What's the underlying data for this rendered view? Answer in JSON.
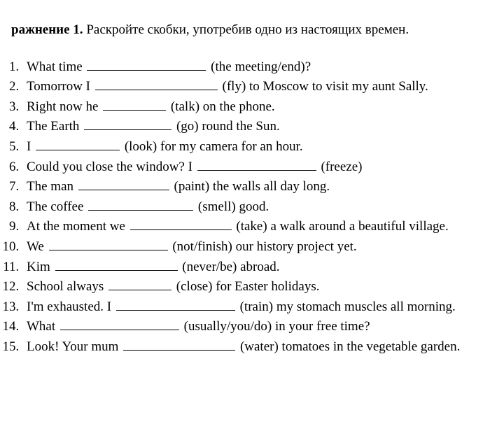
{
  "heading": {
    "label_bold": "ражнение 1.",
    "instruction": "Раскройте скобки, употребив одно из настоящих времен."
  },
  "items": [
    {
      "pre": "What time ",
      "blank_w": 170,
      "post": " (the meeting/end)?"
    },
    {
      "pre": "Tomorrow I ",
      "blank_w": 175,
      "post": " (fly) to Moscow to visit my aunt Sally."
    },
    {
      "pre": "Right now he ",
      "blank_w": 90,
      "post": " (talk) on the phone."
    },
    {
      "pre": "The Earth ",
      "blank_w": 125,
      "post": " (go) round the Sun."
    },
    {
      "pre": "I ",
      "blank_w": 120,
      "post": " (look) for my camera for an hour."
    },
    {
      "pre": "Could you close the window? I ",
      "blank_w": 170,
      "post": " (freeze)"
    },
    {
      "pre": "The man ",
      "blank_w": 130,
      "post": " (paint) the walls all day long."
    },
    {
      "pre": "The coffee ",
      "blank_w": 150,
      "post": " (smell) good."
    },
    {
      "pre": "At the moment we ",
      "blank_w": 145,
      "post": " (take) a walk around a beautiful village."
    },
    {
      "pre": "We ",
      "blank_w": 170,
      "post": " (not/finish) our history project yet."
    },
    {
      "pre": "Kim ",
      "blank_w": 175,
      "post": " (never/be) abroad."
    },
    {
      "pre": "School always ",
      "blank_w": 90,
      "post": "  (close) for Easter holidays."
    },
    {
      "pre": "I'm exhausted. I ",
      "blank_w": 170,
      "post": " (train) my stomach muscles all morning."
    },
    {
      "pre": "What ",
      "blank_w": 170,
      "post": " (usually/you/do) in your free time?"
    },
    {
      "pre": "Look! Your mum ",
      "blank_w": 160,
      "post": " (water) tomatoes in the vegetable garden."
    }
  ]
}
